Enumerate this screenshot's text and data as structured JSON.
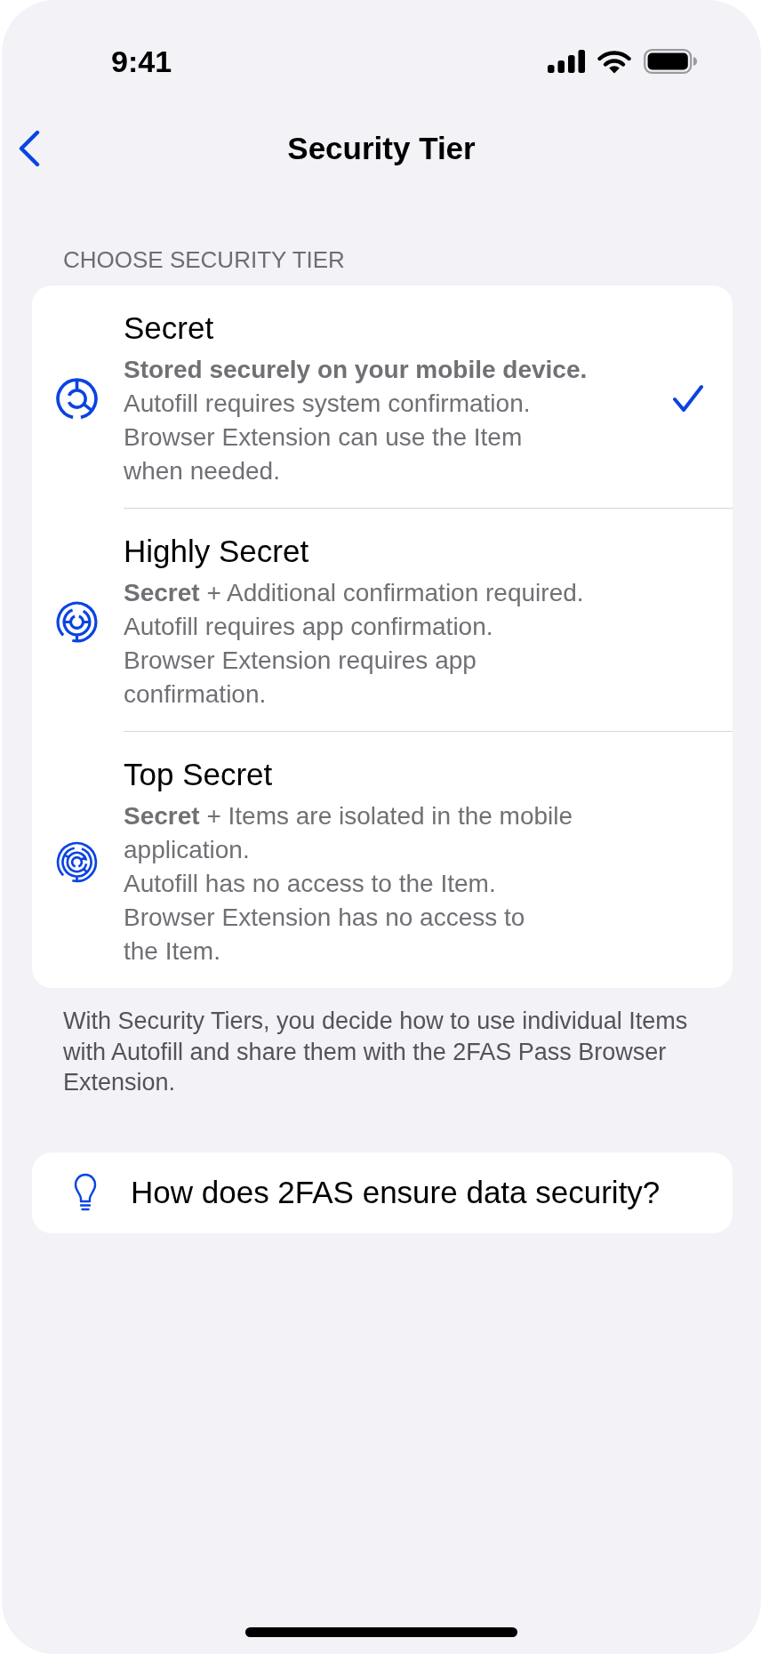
{
  "status_bar": {
    "time": "9:41"
  },
  "navigation": {
    "title": "Security Tier"
  },
  "tier_section": {
    "header": "CHOOSE SECURITY TIER",
    "tiers": [
      {
        "kind": "secret",
        "title": "Secret",
        "selected": true,
        "paragraphs": [
          {
            "text": "Stored securely on your mobile device.",
            "bold": true
          },
          {
            "text": "Autofill requires system confirmation.",
            "bold": false
          },
          {
            "text": "Browser Extension can use the Item when needed.",
            "bold": false
          }
        ]
      },
      {
        "kind": "highly_secret",
        "title": "Highly Secret",
        "selected": false,
        "paragraphs": [
          {
            "text": "**Secret** + Additional confirmation required.",
            "bold": false
          },
          {
            "text": "Autofill requires app confirmation.",
            "bold": false
          },
          {
            "text": "Browser Extension requires app confirmation.",
            "bold": false
          }
        ]
      },
      {
        "kind": "top_secret",
        "title": "Top Secret",
        "selected": false,
        "paragraphs": [
          {
            "text": "**Secret** + Items are isolated in the mobile application.",
            "bold": false
          },
          {
            "text": "Autofill has no access to the Item.",
            "bold": false
          },
          {
            "text": "Browser Extension has no access to the Item.",
            "bold": false
          }
        ]
      }
    ],
    "footer": "With Security Tiers, you decide how to use individual Items with Autofill and share them with the 2FAS Pass Browser Extension."
  },
  "help_link": {
    "label": "How does 2FAS ensure data security?"
  }
}
